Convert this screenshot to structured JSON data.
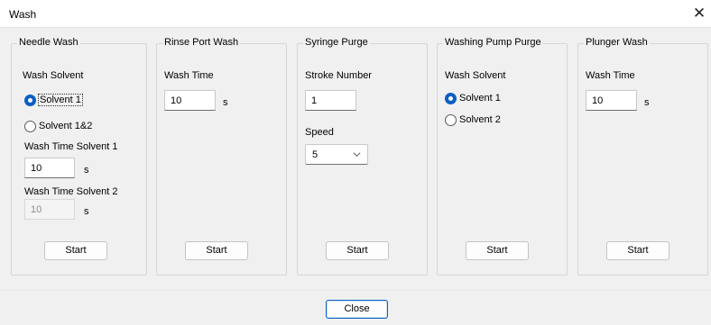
{
  "window": {
    "title": "Wash",
    "close_glyph": "✕"
  },
  "needle_wash": {
    "title": "Needle Wash",
    "wash_solvent_label": "Wash Solvent",
    "solvent_1": "Solvent 1",
    "solvent_1_2": "Solvent 1&2",
    "selected_solvent": "Solvent 1",
    "time_solvent1_label": "Wash Time Solvent 1",
    "time_solvent1_value": "10",
    "time_solvent2_label": "Wash Time Solvent 2",
    "time_solvent2_value": "10",
    "unit": "s",
    "start_label": "Start"
  },
  "rinse_port_wash": {
    "title": "Rinse Port Wash",
    "wash_time_label": "Wash Time",
    "wash_time_value": "10",
    "unit": "s",
    "start_label": "Start"
  },
  "syringe_purge": {
    "title": "Syringe Purge",
    "stroke_label": "Stroke Number",
    "stroke_value": "1",
    "speed_label": "Speed",
    "speed_value": "5",
    "start_label": "Start"
  },
  "washing_pump_purge": {
    "title": "Washing Pump Purge",
    "wash_solvent_label": "Wash Solvent",
    "solvent_1": "Solvent 1",
    "solvent_2": "Solvent 2",
    "selected_solvent": "Solvent 1",
    "start_label": "Start"
  },
  "plunger_wash": {
    "title": "Plunger Wash",
    "wash_time_label": "Wash Time",
    "wash_time_value": "10",
    "unit": "s",
    "start_label": "Start"
  },
  "footer": {
    "close_label": "Close"
  },
  "colors": {
    "accent": "#0a5fc4",
    "background": "#f0f0f0",
    "titlebar": "#ffffff"
  },
  "icons": {
    "window_close": "close-icon",
    "combo": "chevron-down-icon"
  }
}
